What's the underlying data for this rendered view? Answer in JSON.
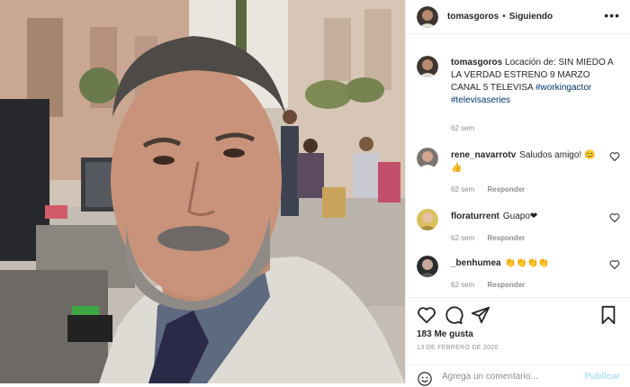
{
  "colors": {
    "link": "#00376b",
    "muted": "#8e8e8e",
    "heart": "#ed4956",
    "publish": "#b2dffc"
  },
  "post": {
    "username": "tomasgoros",
    "follow_status": "Siguiendo",
    "more_icon": "ellipsis-icon"
  },
  "caption": {
    "username": "tomasgoros",
    "text": "Locación de: SIN MIEDO A LA VERDAD ESTRENO 9 MARZO CANAL 5 TELEVISA",
    "hashtags": "#workingactor #televisaseries",
    "time": "62 sem"
  },
  "comments": [
    {
      "username": "rene_navarrotv",
      "text": "Saludos amigo! 😊👍",
      "time": "62 sem",
      "reply": "Responder"
    },
    {
      "username": "floraturrent",
      "text": "Guapo❤",
      "time": "62 sem",
      "reply": "Responder"
    },
    {
      "username": "_benhumea",
      "text": "👏👏👏👏",
      "time": "62 sem",
      "reply": "Responder"
    }
  ],
  "actions": {
    "likes": "183 Me gusta",
    "date": "13 DE FEBRERO DE 2020",
    "icons": [
      "heart-icon",
      "comment-icon",
      "share-icon",
      "bookmark-icon"
    ]
  },
  "add_comment": {
    "placeholder": "Agrega un comentario...",
    "publish": "Publicar"
  }
}
